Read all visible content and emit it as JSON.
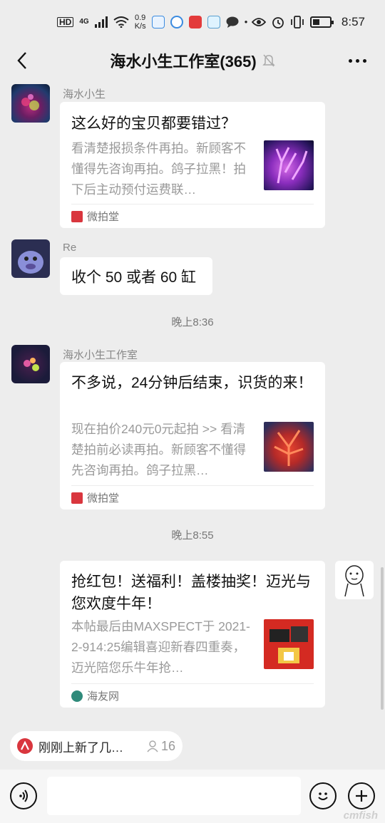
{
  "status_bar": {
    "hd": "HD",
    "net": "4G",
    "speed_value": "0.9",
    "speed_unit": "K/s",
    "time": "8:57"
  },
  "header": {
    "title": "海水小生工作室(365)"
  },
  "messages": [
    {
      "sender": "海水小生",
      "title": "这么好的宝贝都要错过？",
      "desc": "看清楚报损条件再拍。新顾客不懂得先咨询再拍。鸽子拉黑！拍下后主动预付运费联…",
      "source": "微拍堂"
    },
    {
      "sender": "Re",
      "text": "收个 50 或者 60 缸"
    },
    {
      "sender": "海水小生工作室",
      "title": "不多说，24分钟后结束，识货的来！",
      "desc": "现在拍价240元0元起拍 >> 看清楚拍前必读再拍。新顾客不懂得先咨询再拍。鸽子拉黑…",
      "source": "微拍堂"
    },
    {
      "title": "抢红包！送福利！盖楼抽奖！迈光与您欢度牛年！",
      "desc": "本帖最后由MAXSPECT于 2021-2-914:25编辑喜迎新春四重奏，迈光陪您乐牛年抢…",
      "source": "海友网"
    }
  ],
  "timestamps": [
    "晚上8:36",
    "晚上8:55"
  ],
  "announcement": {
    "text": "刚刚上新了几…",
    "count": "16"
  },
  "input": {
    "placeholder": ""
  },
  "watermark": "cmfish",
  "colors": {
    "background": "#ededed",
    "bubble": "#ffffff",
    "source_red": "#d9363e"
  }
}
